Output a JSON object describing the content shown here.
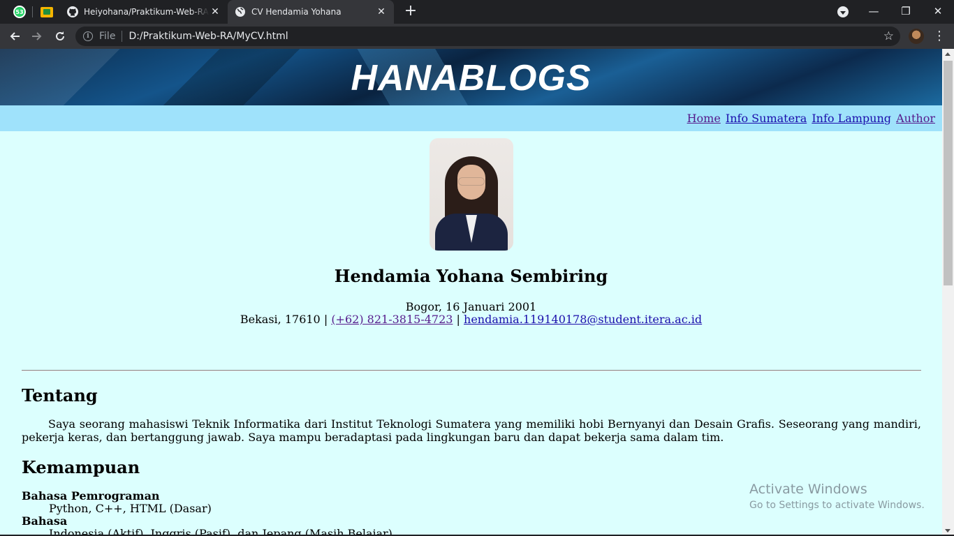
{
  "browser": {
    "pinned_tabs": [
      {
        "name": "whatsapp",
        "badge": "53"
      },
      {
        "name": "google-classroom"
      }
    ],
    "tabs": [
      {
        "title": "Heiyohana/Praktikum-Web-RA at",
        "favicon": "github-icon",
        "active": false
      },
      {
        "title": "CV Hendamia Yohana",
        "favicon": "globe-icon",
        "active": true
      }
    ],
    "close_glyph": "✕",
    "new_tab_glyph": "+",
    "window": {
      "minimize": "—",
      "restore": "❐",
      "close": "✕"
    },
    "address": {
      "scheme_label": "File",
      "url": "D:/Praktikum-Web-RA/MyCV.html"
    }
  },
  "page": {
    "banner_title": "HANABLOGS",
    "nav": [
      {
        "label": "Home",
        "visited": true
      },
      {
        "label": "Info Sumatera",
        "visited": false
      },
      {
        "label": "Info Lampung",
        "visited": false
      },
      {
        "label": "Author",
        "visited": true
      }
    ],
    "profile": {
      "name": "Hendamia Yohana Sembiring",
      "birth": "Bogor, 16 Januari 2001",
      "address": "Bekasi, 17610",
      "separator": "|",
      "phone": "(+62) 821-3815-4723",
      "email": "hendamia.119140178@student.itera.ac.id"
    },
    "sections": {
      "about_title": "Tentang",
      "about_text": "Saya seorang mahasiswi Teknik Informatika dari Institut Teknologi Sumatera yang memiliki hobi Bernyanyi dan Desain Grafis. Seseorang yang mandiri, pekerja keras, dan bertanggung jawab. Saya mampu beradaptasi pada lingkungan baru dan dapat bekerja sama dalam tim.",
      "skills_title": "Kemampuan",
      "skills": [
        {
          "term": "Bahasa Pemrograman",
          "desc": "Python, C++, HTML (Dasar)"
        },
        {
          "term": "Bahasa",
          "desc": "Indonesia (Aktif), Inggris (Pasif), dan Jepang (Masih Belajar)"
        }
      ]
    },
    "watermark": {
      "line1": "Activate Windows",
      "line2": "Go to Settings to activate Windows."
    }
  }
}
